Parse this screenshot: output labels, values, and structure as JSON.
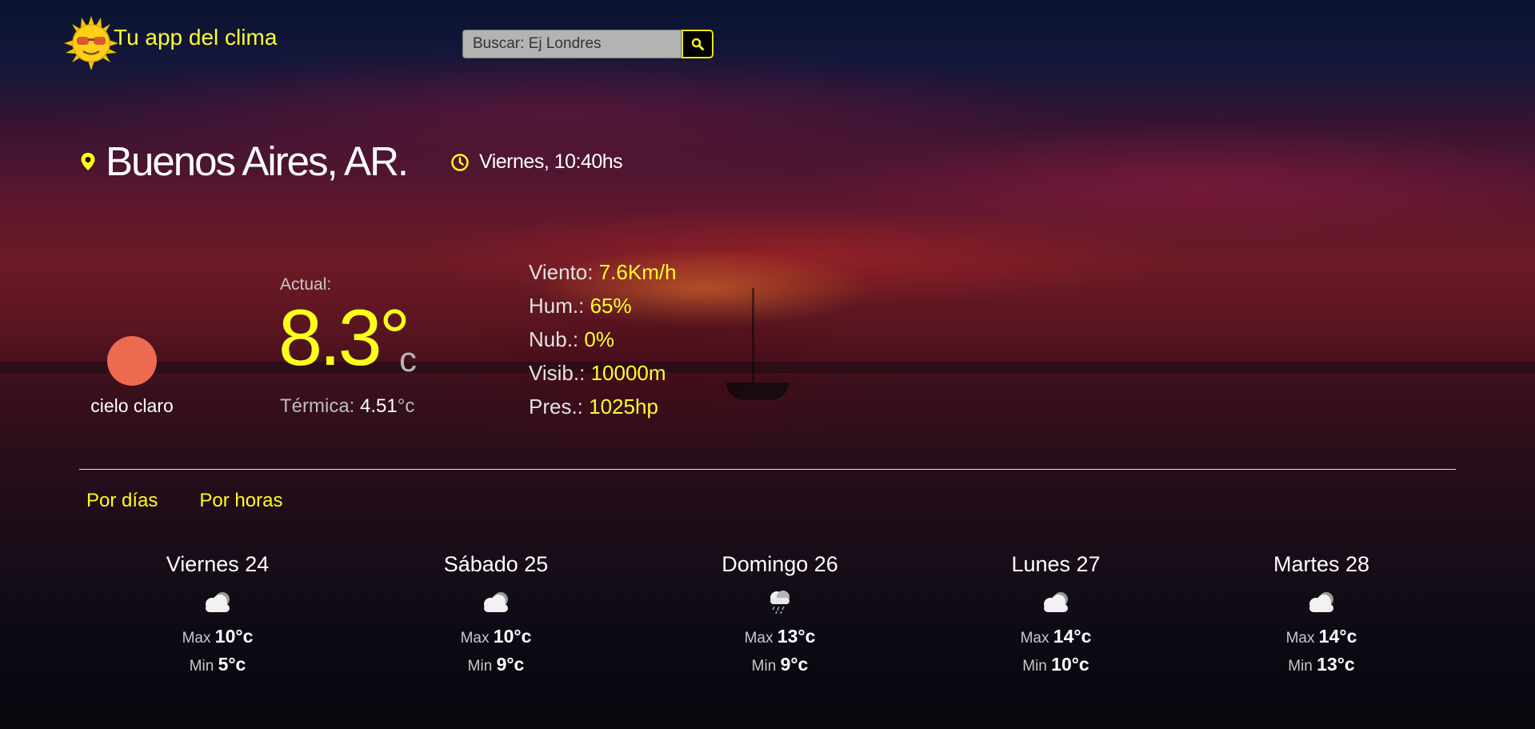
{
  "header": {
    "app_title": "Tu app del clima",
    "logo_icon": "sun-sunglasses-icon",
    "search": {
      "placeholder": "Buscar: Ej Londres",
      "button_icon": "search-icon"
    }
  },
  "location": {
    "city": "Buenos Aires, AR.",
    "datetime": "Viernes, 10:40hs"
  },
  "current": {
    "condition": "cielo claro",
    "condition_color": "#ec6a4f",
    "actual_label": "Actual:",
    "temperature": "8.3°",
    "unit": "c",
    "feels_label": "Térmica:",
    "feels_value": "4.51",
    "feels_unit": "°c"
  },
  "details": [
    {
      "label": "Viento:",
      "value": "7.6Km/h"
    },
    {
      "label": "Hum.:",
      "value": "65%"
    },
    {
      "label": "Nub.:",
      "value": "0%"
    },
    {
      "label": "Visib.:",
      "value": "10000m"
    },
    {
      "label": "Pres.:",
      "value": "1025hp"
    }
  ],
  "tabs": [
    {
      "label": "Por días"
    },
    {
      "label": "Por horas"
    }
  ],
  "forecast": {
    "max_label": "Max",
    "min_label": "Min",
    "days": [
      {
        "name": "Viernes 24",
        "icon": "cloudy-icon",
        "max": "10°c",
        "min": "5°c"
      },
      {
        "name": "Sábado 25",
        "icon": "cloudy-icon",
        "max": "10°c",
        "min": "9°c"
      },
      {
        "name": "Domingo 26",
        "icon": "rain-cloud-icon",
        "max": "13°c",
        "min": "9°c"
      },
      {
        "name": "Lunes 27",
        "icon": "cloudy-icon",
        "max": "14°c",
        "min": "10°c"
      },
      {
        "name": "Martes 28",
        "icon": "cloudy-icon",
        "max": "14°c",
        "min": "13°c"
      }
    ]
  },
  "colors": {
    "accent": "#ffff1a",
    "text": "#ffffff"
  }
}
